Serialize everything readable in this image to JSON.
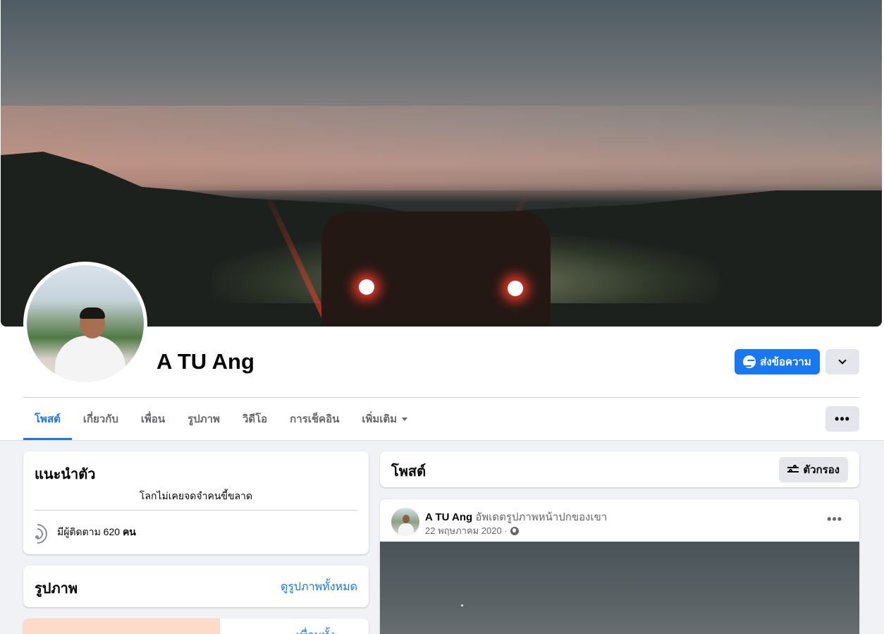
{
  "profile": {
    "name": "A TU Ang",
    "message_button": "ส่งข้อความ"
  },
  "tabs": [
    {
      "label": "โพสต์",
      "active": true
    },
    {
      "label": "เกี่ยวกับ"
    },
    {
      "label": "เพื่อน"
    },
    {
      "label": "รูปภาพ"
    },
    {
      "label": "วิดีโอ"
    },
    {
      "label": "การเช็คอิน"
    },
    {
      "label": "เพิ่มเติม",
      "dropdown": true
    }
  ],
  "intro": {
    "title": "แนะนำตัว",
    "bio": "โลกไม่เคยจดจำคนขี้ขลาด",
    "followers_prefix": "มีผู้ติดตาม 620 ",
    "followers_unit": "คน"
  },
  "photos": {
    "title": "รูปภาพ",
    "see_all": "ดูรูปภาพทั้งหมด"
  },
  "friends_partial": {
    "link": "เพื่อนทั้ง"
  },
  "posts": {
    "title": "โพสต์",
    "filter_label": "ตัวกรอง"
  },
  "post": {
    "author": "A TU Ang",
    "action": "อัพเดตรูปภาพหน้าปกของเขา",
    "date": "22 พฤษภาคม 2020 ·"
  },
  "colors": {
    "accent": "#1877f2",
    "background": "#f0f2f5",
    "secondary_button": "#e4e6eb"
  }
}
